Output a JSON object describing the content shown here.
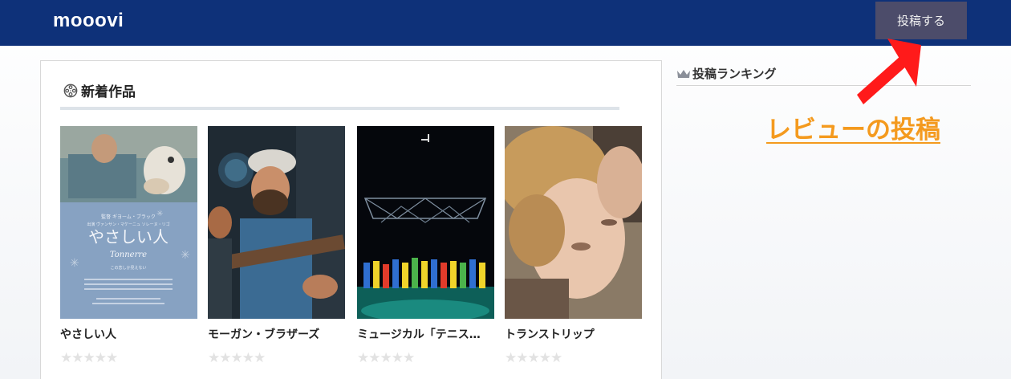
{
  "header": {
    "logo": "mooovi",
    "post_button": "投稿する"
  },
  "main": {
    "section_title": "新着作品",
    "section_icon": "film-reel-icon",
    "movies": [
      {
        "title": "やさしい人",
        "rating": 0,
        "max_rating": 5,
        "poster_text": "やさしい人",
        "poster_subtitle": "Tonnerre"
      },
      {
        "title": "モーガン・ブラザーズ",
        "rating": 0,
        "max_rating": 5
      },
      {
        "title": "ミュージカル「テニス…",
        "rating": 0,
        "max_rating": 5
      },
      {
        "title": "トランストリップ",
        "rating": 0,
        "max_rating": 5
      }
    ]
  },
  "sidebar": {
    "ranking_title": "投稿ランキング",
    "ranking_icon": "crown-icon"
  },
  "annotation": {
    "label": "レビューの投稿",
    "color": "#f49a1e",
    "arrow_color": "#ff1a1a"
  },
  "colors": {
    "header_bg": "#0e3179",
    "button_bg": "#4c4c6a",
    "star_empty": "#e2e2e2"
  }
}
